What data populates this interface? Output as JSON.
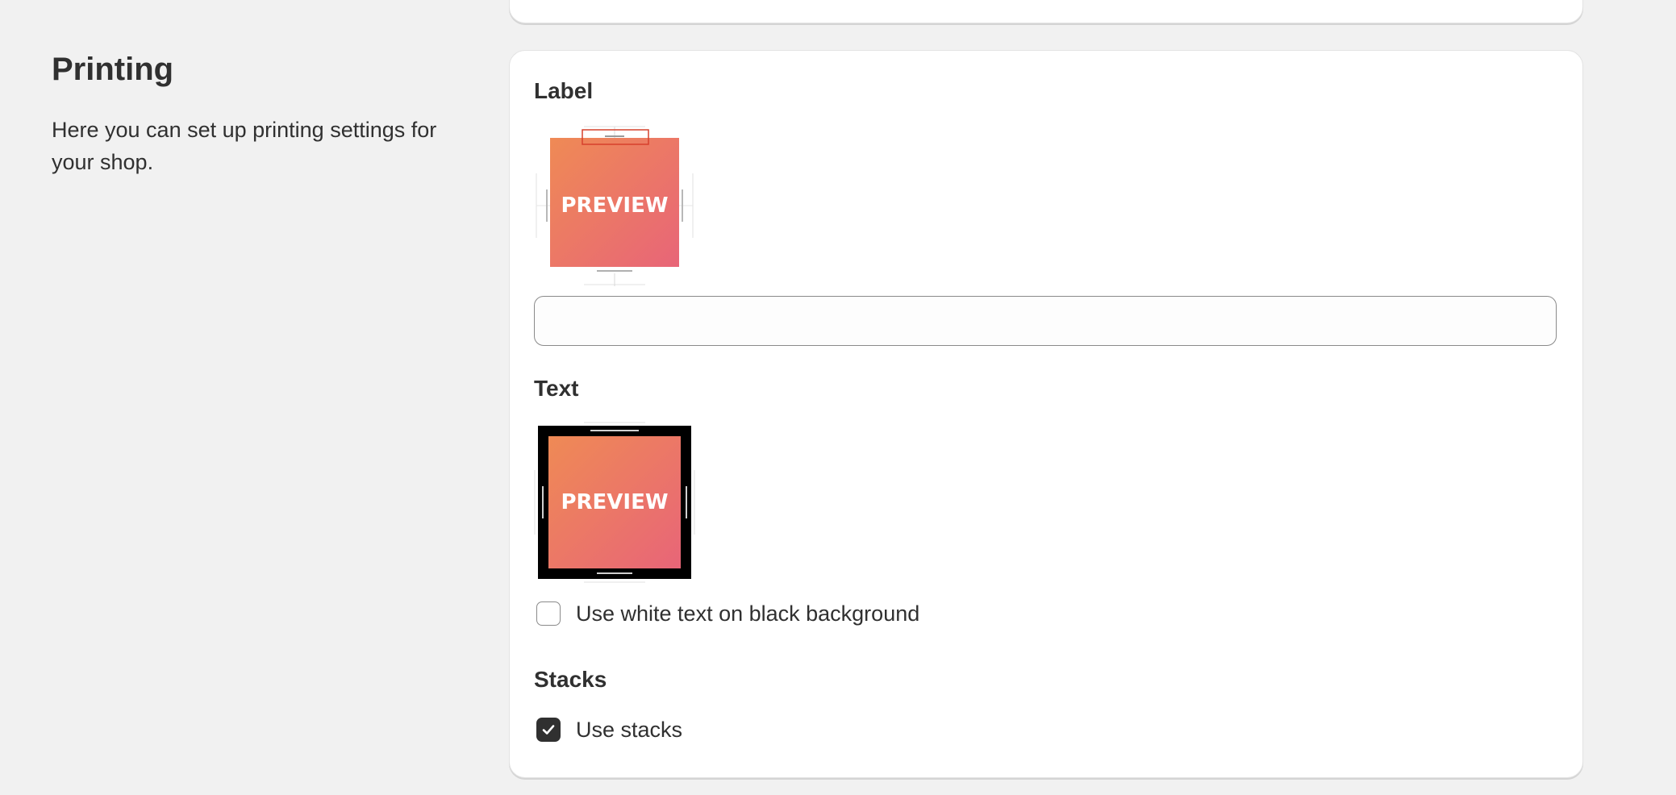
{
  "section": {
    "title": "Printing",
    "description": "Here you can set up printing settings for your shop."
  },
  "label": {
    "heading": "Label",
    "preview_text": "PREVIEW",
    "input_value": "",
    "input_placeholder": ""
  },
  "text": {
    "heading": "Text",
    "preview_text": "PREVIEW",
    "white_on_black_label": "Use white text on black background",
    "white_on_black_checked": false
  },
  "stacks": {
    "heading": "Stacks",
    "use_stacks_label": "Use stacks",
    "use_stacks_checked": true
  },
  "colors": {
    "page_bg": "#f1f1f1",
    "card_bg": "#ffffff",
    "text": "#303030",
    "gradient_start": "#ef8a55",
    "gradient_end": "#e86578",
    "highlight_box": "#d6402c"
  }
}
